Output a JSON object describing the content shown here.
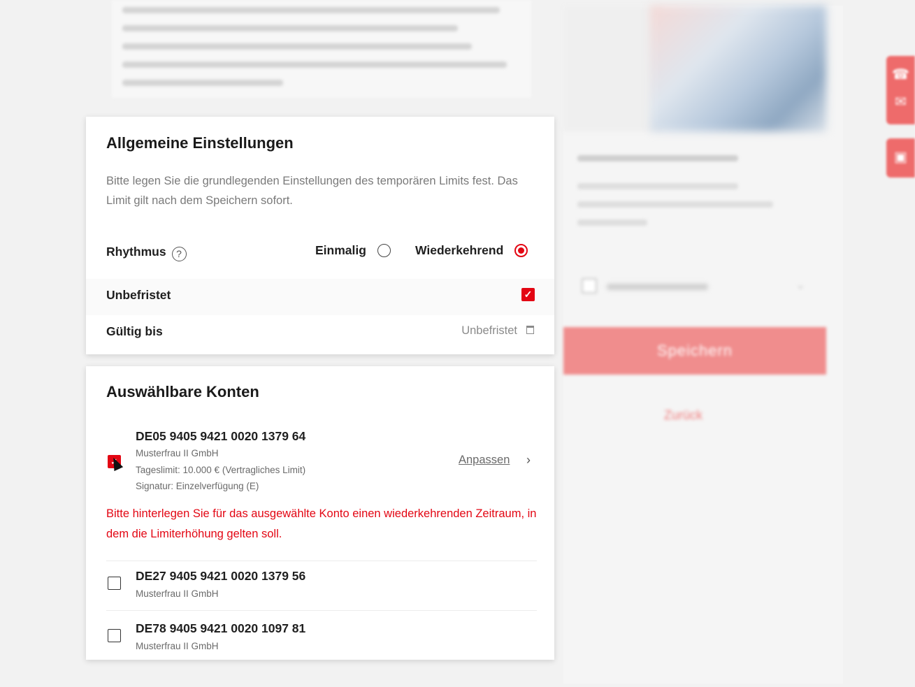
{
  "settings": {
    "title": "Allgemeine Einstellungen",
    "description": "Bitte legen Sie die grundlegenden Einstellungen des temporären Limits fest. Das Limit gilt nach dem Speichern sofort.",
    "rhythm_label": "Rhythmus",
    "help_symbol": "?",
    "rhythm_options": [
      {
        "label": "Einmalig",
        "selected": false
      },
      {
        "label": "Wiederkehrend",
        "selected": true
      }
    ],
    "unlimited_label": "Unbefristet",
    "unlimited_checked": true,
    "check_symbol": "✓",
    "valid_until_label": "Gültig bis",
    "valid_until_value": "Unbefristet"
  },
  "accounts": {
    "title": "Auswählbare Konten",
    "items": [
      {
        "iban": "DE05 9405 9421 0020 1379 64",
        "holder": "Musterfrau II GmbH",
        "daily_limit": "Tageslimit: 10.000 € (Vertragliches Limit)",
        "signature": "Signatur: Einzelverfügung (E)",
        "checked": true,
        "action_label": "Anpassen",
        "action_chevron": "›"
      },
      {
        "iban": "DE27 9405 9421 0020 1379 56",
        "holder": "Musterfrau II GmbH",
        "checked": false
      },
      {
        "iban": "DE78 9405 9421 0020 1097 81",
        "holder": "Musterfrau II GmbH",
        "checked": false
      }
    ],
    "error_message": "Bitte hinterlegen Sie für das ausgewählte Konto einen wiederkehrenden Zeitraum, in dem die Limiterhöhung gelten soll."
  },
  "sidebar": {
    "save_label": "Speichern",
    "back_label": "Zurück"
  },
  "colors": {
    "accent": "#e30613",
    "accent_faded": "#f08d8d",
    "background": "#f2f2f2"
  },
  "icons": [
    "help-icon",
    "calendar-icon",
    "chevron-right-icon",
    "check-icon",
    "mouse-cursor-icon",
    "phone-icon",
    "mail-icon"
  ]
}
